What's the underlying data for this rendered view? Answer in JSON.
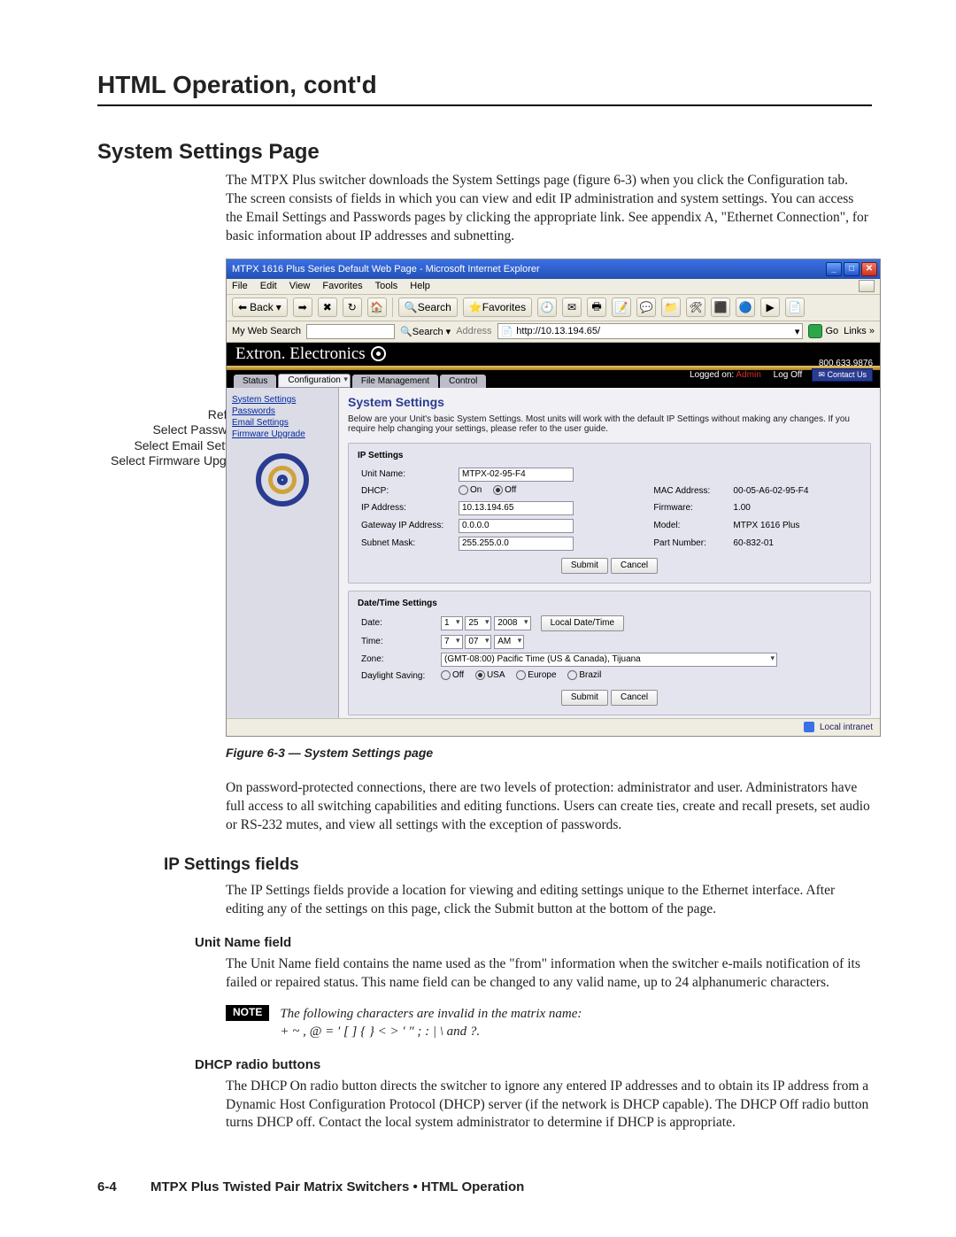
{
  "headings": {
    "h1": "HTML Operation, cont'd",
    "h2_system": "System Settings Page",
    "h3_ip": "IP Settings fields",
    "h4_unit": "Unit Name field",
    "h4_dhcp": "DHCP radio buttons"
  },
  "paragraphs": {
    "system_intro": "The MTPX Plus switcher downloads the System Settings page (figure 6-3) when you click the Configuration tab.  The screen consists of fields in which you can view and edit IP administration and system settings.  You can access the Email Settings and Passwords pages by clicking the appropriate link.  See appendix A, \"Ethernet Connection\", for basic information about IP addresses and subnetting.",
    "caption": "Figure 6-3 — System Settings page",
    "protection": "On password-protected connections, there are two levels of protection: administrator and user.  Administrators have full access to all switching capabilities and editing functions.  Users can create ties, create and recall presets, set audio or RS-232 mutes, and view all settings with the exception of passwords.",
    "ipfields": "The IP Settings fields provide a location for viewing and editing settings unique to the Ethernet interface.  After editing any of the settings on this page, click the Submit button at the bottom of the page.",
    "unitname": "The Unit Name field contains the name used as the \"from\" information when the switcher e-mails notification of its failed or repaired status.  This name field can be changed to any valid name, up to 24 alphanumeric characters.",
    "note_label": "NOTE",
    "note_l1": "The following characters are invalid in the matrix name:",
    "note_l2": "+  ~  ,  @  =  '  [  ]  {  }  <  >  '  \"  ;  :  |  \\  and ?.",
    "dhcp": "The DHCP On radio button directs the switcher to ignore any entered IP addresses and to obtain its IP address from a Dynamic Host Configuration Protocol (DHCP) server (if the network is DHCP capable).  The DHCP Off radio button turns DHCP off. Contact the local system administrator to determine if DHCP is appropriate."
  },
  "footer": {
    "page_num": "6-4",
    "title": "MTPX Plus Twisted Pair Matrix Switchers • HTML Operation"
  },
  "callouts": {
    "refresh": "Refresh",
    "passwords": "Select Passwords",
    "email": "Select Email Settings",
    "firmware": "Select Firmware Upgrade"
  },
  "screenshot": {
    "titlebar": "MTPX 1616 Plus Series Default Web Page - Microsoft Internet Explorer",
    "menus": [
      "File",
      "Edit",
      "View",
      "Favorites",
      "Tools",
      "Help"
    ],
    "toolbar": {
      "back": "Back",
      "search": "Search",
      "favorites": "Favorites"
    },
    "addressbar": {
      "label": "My Web Search",
      "search_btn": "Search",
      "address_label": "Address",
      "url": "http://10.13.194.65/",
      "go": "Go",
      "links": "Links"
    },
    "brand": "Extron. Electronics",
    "tabs": {
      "status": "Status",
      "configuration": "Configuration",
      "file": "File Management",
      "control": "Control"
    },
    "header_right": {
      "phone": "800.633.9876",
      "logged_label": "Logged on:",
      "logged_as": "Admin",
      "logoff": "Log Off",
      "contact": "Contact Us"
    },
    "sidebar": {
      "system": "System Settings",
      "passwords": "Passwords",
      "email": "Email Settings",
      "firmware": "Firmware Upgrade"
    },
    "main": {
      "title": "System Settings",
      "desc": "Below are your Unit's basic System Settings. Most units will work with the default IP Settings without making any changes. If you require help changing your settings, please refer to the user guide.",
      "ip_panel": {
        "title": "IP Settings",
        "unit_name_lbl": "Unit Name:",
        "unit_name_val": "MTPX-02-95-F4",
        "dhcp_lbl": "DHCP:",
        "dhcp_on": "On",
        "dhcp_off": "Off",
        "mac_lbl": "MAC Address:",
        "mac_val": "00-05-A6-02-95-F4",
        "ip_lbl": "IP Address:",
        "ip_val": "10.13.194.65",
        "fw_lbl": "Firmware:",
        "fw_val": "1.00",
        "gw_lbl": "Gateway IP Address:",
        "gw_val": "0.0.0.0",
        "model_lbl": "Model:",
        "model_val": "MTPX 1616 Plus",
        "subnet_lbl": "Subnet Mask:",
        "subnet_val": "255.255.0.0",
        "part_lbl": "Part Number:",
        "part_val": "60-832-01",
        "submit": "Submit",
        "cancel": "Cancel"
      },
      "dt_panel": {
        "title": "Date/Time Settings",
        "date_lbl": "Date:",
        "date_m": "1",
        "date_d": "25",
        "date_y": "2008",
        "local_btn": "Local Date/Time",
        "time_lbl": "Time:",
        "time_h": "7",
        "time_m": "07",
        "time_ap": "AM",
        "zone_lbl": "Zone:",
        "zone_val": "(GMT-08:00) Pacific Time (US & Canada), Tijuana",
        "ds_lbl": "Daylight Saving:",
        "ds_off": "Off",
        "ds_usa": "USA",
        "ds_eu": "Europe",
        "ds_br": "Brazil",
        "submit": "Submit",
        "cancel": "Cancel"
      }
    },
    "statusbar": "Local intranet"
  }
}
